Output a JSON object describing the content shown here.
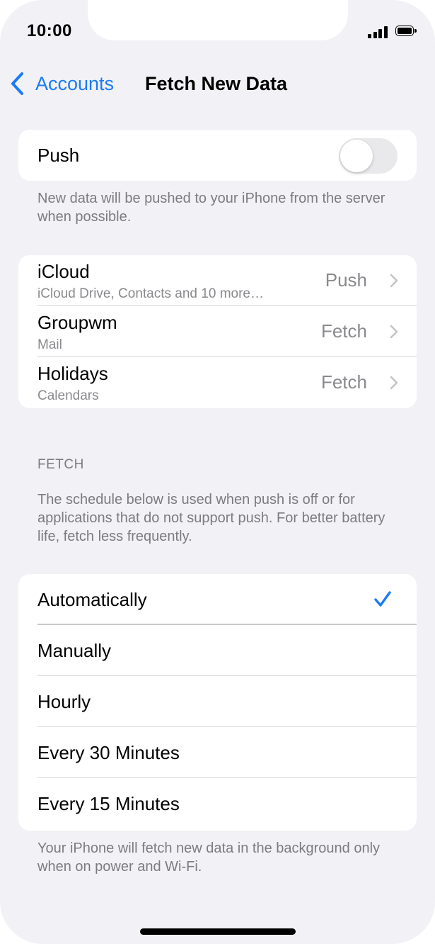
{
  "status_bar": {
    "time": "10:00"
  },
  "nav": {
    "back_label": "Accounts",
    "title": "Fetch New Data"
  },
  "push": {
    "label": "Push",
    "enabled": false,
    "footnote": "New data will be pushed to your iPhone from the server when possible."
  },
  "accounts": [
    {
      "name": "iCloud",
      "detail": "iCloud Drive, Contacts and 10 more…",
      "value": "Push"
    },
    {
      "name": "Groupwm",
      "detail": "Mail",
      "value": "Fetch"
    },
    {
      "name": "Holidays",
      "detail": "Calendars",
      "value": "Fetch"
    }
  ],
  "fetch": {
    "header": "FETCH",
    "description": "The schedule below is used when push is off or for applications that do not support push. For better battery life, fetch less frequently.",
    "options": [
      {
        "label": "Automatically",
        "selected": true
      },
      {
        "label": "Manually",
        "selected": false
      },
      {
        "label": "Hourly",
        "selected": false
      },
      {
        "label": "Every 30 Minutes",
        "selected": false
      },
      {
        "label": "Every 15 Minutes",
        "selected": false
      }
    ],
    "footnote": "Your iPhone will fetch new data in the background only when on power and Wi-Fi."
  },
  "colors": {
    "accent": "#1a7cf5",
    "background": "#f2f1f6",
    "secondary_text": "#8a8a8e"
  },
  "icons": {
    "back": "chevron-left-icon",
    "disclosure": "chevron-right-icon",
    "selected": "checkmark-icon",
    "signal": "cellular-signal-icon",
    "battery": "battery-icon"
  }
}
